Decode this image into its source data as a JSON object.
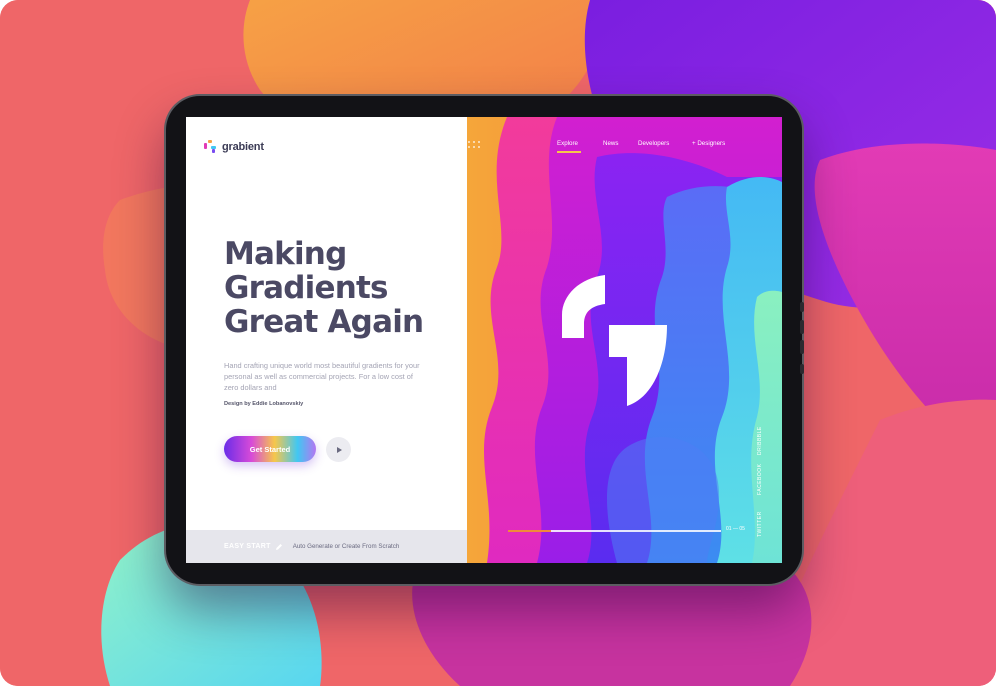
{
  "brand": {
    "name": "grabient"
  },
  "nav": {
    "items": [
      {
        "label": "Explore"
      },
      {
        "label": "News"
      },
      {
        "label": "Developers"
      },
      {
        "label": "+ Designers"
      }
    ],
    "menu_icon": "grid-dots-icon"
  },
  "hero": {
    "title_line1": "Making",
    "title_line2": "Gradients",
    "title_line3": "Great Again",
    "description": "Hand crafting unique world most beautiful gradients for your personal as well as commercial projects. For a low cost of zero dollars and",
    "credit": "Design by Eddie Lobanovskiy",
    "cta_label": "Get Started",
    "play_icon": "play-icon"
  },
  "bottom_bar": {
    "easy_start": "EASY START",
    "auto_generate": "Auto Generate or Create From Scratch"
  },
  "social": {
    "twitter": "TWITTER",
    "facebook": "FACEBOOK",
    "dribbble": "DRIBBBLE"
  },
  "slider": {
    "label": "01 — 05",
    "progress": 0.2
  },
  "colors": {
    "accent_yellow": "#f6c74b",
    "title_color": "#4b4964",
    "background_coral": "#f0686a",
    "purple": "#8a2be2",
    "magenta": "#e23bb5"
  }
}
